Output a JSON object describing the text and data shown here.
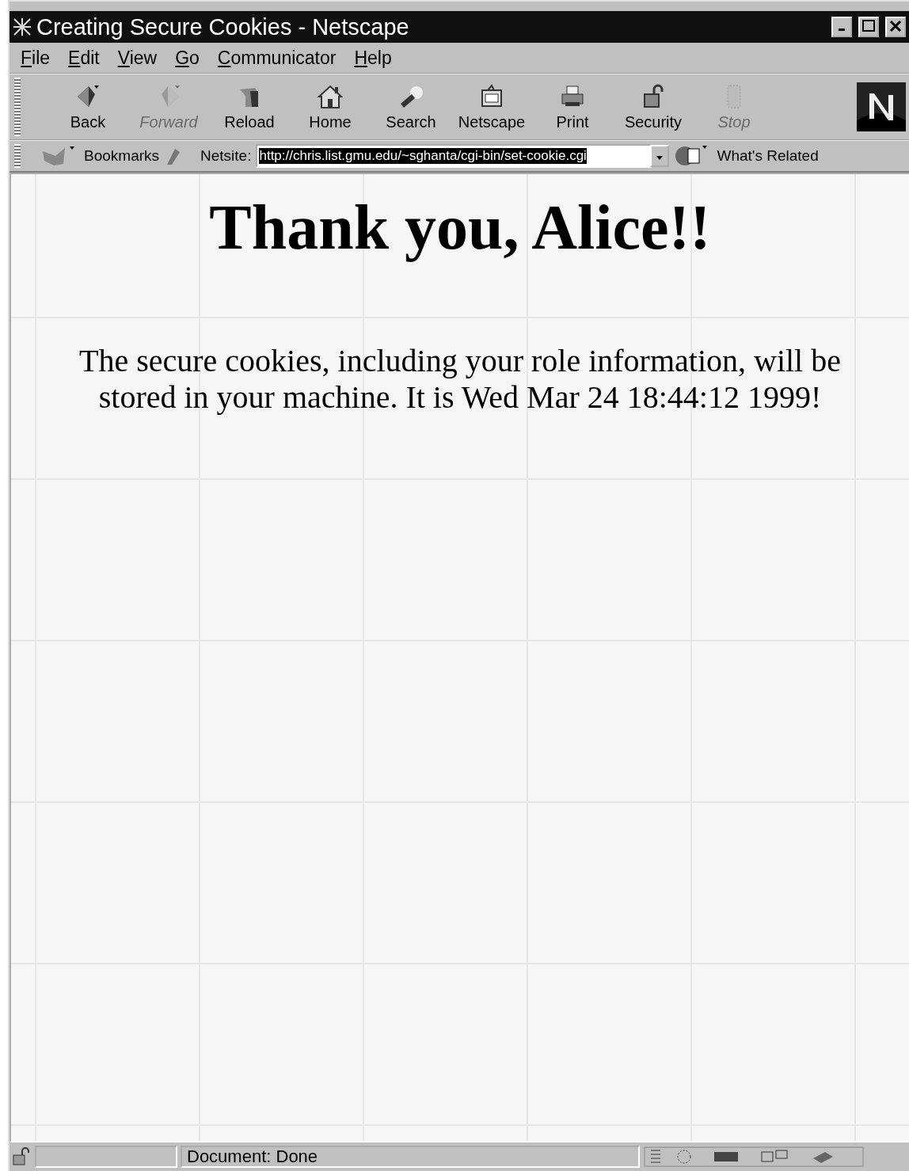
{
  "window": {
    "title": "Creating Secure Cookies - Netscape"
  },
  "menu": [
    "File",
    "Edit",
    "View",
    "Go",
    "Communicator",
    "Help"
  ],
  "toolbar": [
    {
      "label": "Back",
      "kind": "back",
      "disabled": false
    },
    {
      "label": "Forward",
      "kind": "forward",
      "disabled": true
    },
    {
      "label": "Reload",
      "kind": "reload",
      "disabled": false
    },
    {
      "label": "Home",
      "kind": "home",
      "disabled": false
    },
    {
      "label": "Search",
      "kind": "search",
      "disabled": false
    },
    {
      "label": "Netscape",
      "kind": "my",
      "disabled": false
    },
    {
      "label": "Print",
      "kind": "print",
      "disabled": false
    },
    {
      "label": "Security",
      "kind": "security",
      "disabled": false
    },
    {
      "label": "Stop",
      "kind": "stop",
      "disabled": true
    }
  ],
  "location_bar": {
    "bookmarks": "Bookmarks",
    "label": "Netsite:",
    "url": "http://chris.list.gmu.edu/~sghanta/cgi-bin/set-cookie.cgi",
    "url_highlighted": true,
    "related": "What's Related"
  },
  "page": {
    "heading": "Thank you, Alice!!",
    "text": "The secure cookies, including your role information, will be stored in your machine. It is Wed Mar 24 18:44:12 1999!"
  },
  "status_bar": {
    "text": "Document: Done"
  }
}
